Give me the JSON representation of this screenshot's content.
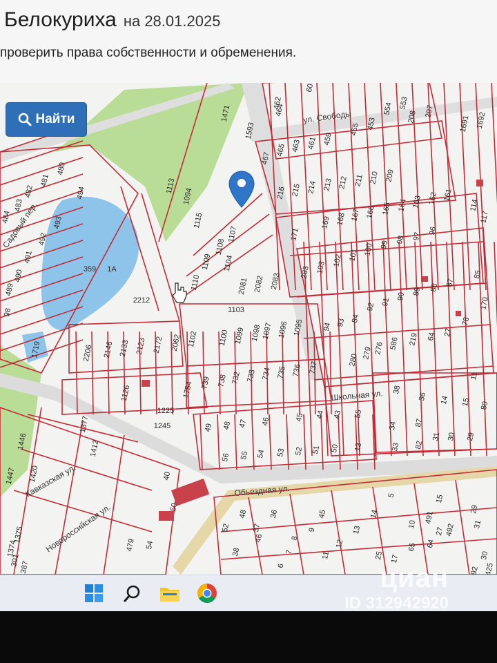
{
  "header": {
    "title": "Белокуриха",
    "date_prefix": "на 28.01.2025",
    "subtitle": "проверить права собственности и обременения."
  },
  "search": {
    "button_label": "Найти"
  },
  "map": {
    "marker_icon": "location-pin-icon",
    "streets": [
      "ул. Свободы",
      "Обьездная ул.",
      "Кавказская ул.",
      "Новороссийская ул.",
      "Садовый пер.",
      "Школьная ул."
    ],
    "parcels": [
      {
        "id": "462"
      },
      {
        "id": "464"
      },
      {
        "id": "60"
      },
      {
        "id": "1471"
      },
      {
        "id": "1593"
      },
      {
        "id": "554"
      },
      {
        "id": "553"
      },
      {
        "id": "465"
      },
      {
        "id": "463"
      },
      {
        "id": "461"
      },
      {
        "id": "459"
      },
      {
        "id": "455"
      },
      {
        "id": "453"
      },
      {
        "id": "208"
      },
      {
        "id": "207"
      },
      {
        "id": "467"
      },
      {
        "id": "216"
      },
      {
        "id": "215"
      },
      {
        "id": "214"
      },
      {
        "id": "213"
      },
      {
        "id": "212"
      },
      {
        "id": "211"
      },
      {
        "id": "210"
      },
      {
        "id": "209"
      },
      {
        "id": "1691"
      },
      {
        "id": "1692"
      },
      {
        "id": "480"
      },
      {
        "id": "481"
      },
      {
        "id": "482"
      },
      {
        "id": "483"
      },
      {
        "id": "494"
      },
      {
        "id": "484"
      },
      {
        "id": "493"
      },
      {
        "id": "492"
      },
      {
        "id": "491"
      },
      {
        "id": "490"
      },
      {
        "id": "489"
      },
      {
        "id": "98"
      },
      {
        "id": "1113"
      },
      {
        "id": "1094"
      },
      {
        "id": "1115"
      },
      {
        "id": "1107"
      },
      {
        "id": "1108"
      },
      {
        "id": "1109"
      },
      {
        "id": "1104"
      },
      {
        "id": "1110"
      },
      {
        "id": "359"
      },
      {
        "id": "1A"
      },
      {
        "id": "2212"
      },
      {
        "id": "2081"
      },
      {
        "id": "2082"
      },
      {
        "id": "2083"
      },
      {
        "id": "1103"
      },
      {
        "id": "1719"
      },
      {
        "id": "171"
      },
      {
        "id": "169"
      },
      {
        "id": "168"
      },
      {
        "id": "167"
      },
      {
        "id": "166"
      },
      {
        "id": "165"
      },
      {
        "id": "164"
      },
      {
        "id": "163"
      },
      {
        "id": "162"
      },
      {
        "id": "161"
      },
      {
        "id": "114"
      },
      {
        "id": "117"
      },
      {
        "id": "96"
      },
      {
        "id": "97"
      },
      {
        "id": "98"
      },
      {
        "id": "99"
      },
      {
        "id": "100"
      },
      {
        "id": "101"
      },
      {
        "id": "102"
      },
      {
        "id": "103"
      },
      {
        "id": "283"
      },
      {
        "id": "85"
      },
      {
        "id": "87"
      },
      {
        "id": "88"
      },
      {
        "id": "89"
      },
      {
        "id": "90"
      },
      {
        "id": "91"
      },
      {
        "id": "92"
      },
      {
        "id": "84"
      },
      {
        "id": "93"
      },
      {
        "id": "94"
      },
      {
        "id": "170"
      },
      {
        "id": "78"
      },
      {
        "id": "27"
      },
      {
        "id": "64"
      },
      {
        "id": "219"
      },
      {
        "id": "586"
      },
      {
        "id": "276"
      },
      {
        "id": "279"
      },
      {
        "id": "280"
      },
      {
        "id": "2206"
      },
      {
        "id": "2146"
      },
      {
        "id": "2133"
      },
      {
        "id": "2123"
      },
      {
        "id": "2172"
      },
      {
        "id": "2062"
      },
      {
        "id": "1102"
      },
      {
        "id": "1100"
      },
      {
        "id": "1099"
      },
      {
        "id": "1098"
      },
      {
        "id": "1097"
      },
      {
        "id": "1096"
      },
      {
        "id": "1095"
      },
      {
        "id": "1126"
      },
      {
        "id": "1754"
      },
      {
        "id": "739"
      },
      {
        "id": "738"
      },
      {
        "id": "732"
      },
      {
        "id": "733"
      },
      {
        "id": "734"
      },
      {
        "id": "735"
      },
      {
        "id": "736"
      },
      {
        "id": "737"
      },
      {
        "id": "11"
      },
      {
        "id": "38"
      },
      {
        "id": "36"
      },
      {
        "id": "14"
      },
      {
        "id": "15"
      },
      {
        "id": "80"
      },
      {
        "id": "1225"
      },
      {
        "id": "1245"
      },
      {
        "id": "49"
      },
      {
        "id": "48"
      },
      {
        "id": "47"
      },
      {
        "id": "46"
      },
      {
        "id": "45"
      },
      {
        "id": "44"
      },
      {
        "id": "43"
      },
      {
        "id": "55"
      },
      {
        "id": "34"
      },
      {
        "id": "87"
      },
      {
        "id": "31"
      },
      {
        "id": "30"
      },
      {
        "id": "29"
      },
      {
        "id": "33"
      },
      {
        "id": "82"
      },
      {
        "id": "1377"
      },
      {
        "id": "1446"
      },
      {
        "id": "1412"
      },
      {
        "id": "1447"
      },
      {
        "id": "1420"
      },
      {
        "id": "56"
      },
      {
        "id": "55"
      },
      {
        "id": "54"
      },
      {
        "id": "53"
      },
      {
        "id": "52"
      },
      {
        "id": "51"
      },
      {
        "id": "50"
      },
      {
        "id": "13"
      },
      {
        "id": "40"
      },
      {
        "id": "50"
      },
      {
        "id": "1375"
      },
      {
        "id": "1374"
      },
      {
        "id": "301"
      },
      {
        "id": "1387"
      },
      {
        "id": "479"
      },
      {
        "id": "54"
      },
      {
        "id": "52"
      },
      {
        "id": "48"
      },
      {
        "id": "37"
      },
      {
        "id": "36"
      },
      {
        "id": "46"
      },
      {
        "id": "38"
      },
      {
        "id": "45"
      },
      {
        "id": "9"
      },
      {
        "id": "8"
      },
      {
        "id": "7"
      },
      {
        "id": "6"
      },
      {
        "id": "5"
      },
      {
        "id": "14"
      },
      {
        "id": "13"
      },
      {
        "id": "12"
      },
      {
        "id": "11"
      },
      {
        "id": "10"
      },
      {
        "id": "15"
      },
      {
        "id": "17"
      },
      {
        "id": "25"
      },
      {
        "id": "65"
      },
      {
        "id": "64"
      },
      {
        "id": "27"
      },
      {
        "id": "492"
      },
      {
        "id": "491"
      },
      {
        "id": "31"
      },
      {
        "id": "29"
      },
      {
        "id": "30"
      },
      {
        "id": "792"
      },
      {
        "id": "425"
      },
      {
        "id": "32"
      }
    ]
  },
  "taskbar": {
    "items": [
      "windows-start-icon",
      "search-icon",
      "file-explorer-icon",
      "chrome-icon"
    ]
  },
  "watermark": {
    "brand": "циан",
    "id_text": "ID 312942920"
  },
  "colors": {
    "parcel_line": "#c32b36",
    "road": "#d9d9d9",
    "park": "#b8dc96",
    "water": "#8fc4ea",
    "button": "#2f6fb8"
  }
}
